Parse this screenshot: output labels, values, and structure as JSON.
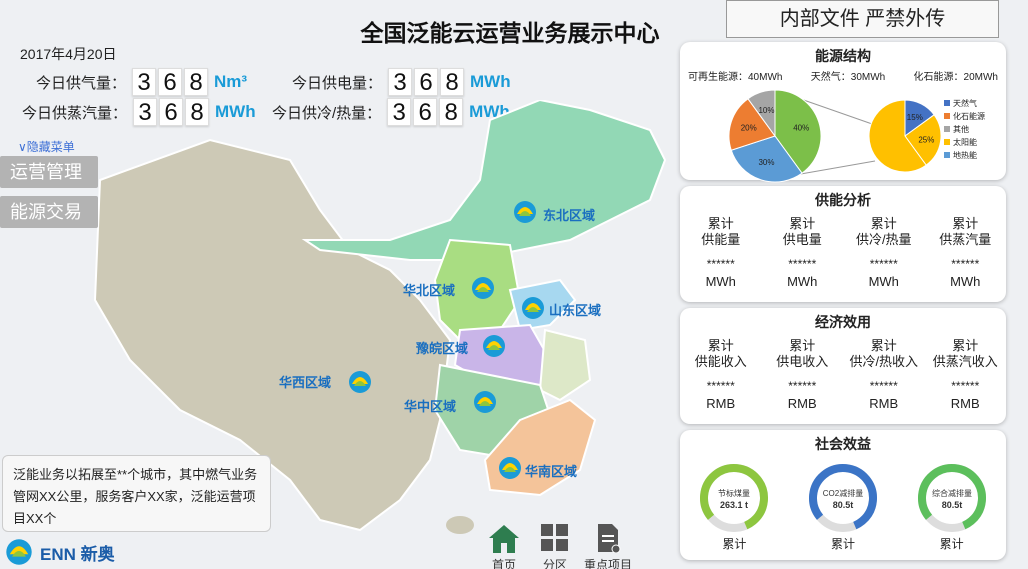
{
  "header": {
    "title": "全国泛能云运营业务展示中心",
    "notice": "内部文件  严禁外传",
    "date": "2017年4月20日"
  },
  "stats": {
    "gas": {
      "label": "今日供气量：",
      "digits": [
        "3",
        "6",
        "8"
      ],
      "unit": "Nm³"
    },
    "steam": {
      "label": "今日供蒸汽量：",
      "digits": [
        "3",
        "6",
        "8"
      ],
      "unit": "MWh"
    },
    "electricity": {
      "label": "今日供电量：",
      "digits": [
        "3",
        "6",
        "8"
      ],
      "unit": "MWh"
    },
    "heat": {
      "label": "今日供冷/热量：",
      "digits": [
        "3",
        "6",
        "8"
      ],
      "unit": "MWh"
    }
  },
  "sidebar": {
    "hide_menu": "∨隐藏菜单",
    "items": [
      {
        "label": "运营管理"
      },
      {
        "label": "能源交易"
      }
    ]
  },
  "map": {
    "regions": [
      {
        "label": "东北区域"
      },
      {
        "label": "华北区域"
      },
      {
        "label": "山东区域"
      },
      {
        "label": "豫皖区域"
      },
      {
        "label": "华西区域"
      },
      {
        "label": "华中区域"
      },
      {
        "label": "华南区域"
      }
    ]
  },
  "info": {
    "text": "泛能业务以拓展至**个城市，其中燃气业务管网XX公里，服务客户XX家，泛能运营项目XX个"
  },
  "logo": {
    "text": "ENN 新奥"
  },
  "nav": {
    "home": "首页",
    "region": "分区",
    "projects": "重点项目"
  },
  "energy_structure": {
    "title": "能源结构",
    "legend_top": [
      "可再生能源：40MWh",
      "天然气：30MWh",
      "化石能源：20MWh"
    ],
    "chart_data": {
      "type": "pie",
      "pie1": {
        "slices": [
          {
            "label": "40%",
            "value": 40,
            "color": "#7cbf49"
          },
          {
            "label": "30%",
            "value": 30,
            "color": "#5b9bd5"
          },
          {
            "label": "20%",
            "value": 20,
            "color": "#ed7d31"
          },
          {
            "label": "10%",
            "value": 10,
            "color": "#a5a5a5"
          }
        ]
      },
      "pie2": {
        "slices": [
          {
            "label": "15%",
            "value": 15,
            "color": "#4472c4"
          },
          {
            "label": "25%",
            "value": 25,
            "color": "#ffc000"
          },
          {
            "label": "",
            "value": 60,
            "color": "#ffc000"
          }
        ],
        "legend": [
          {
            "name": "天然气",
            "color": "#4472c4"
          },
          {
            "name": "化石能源",
            "color": "#ed7d31"
          },
          {
            "name": "其他",
            "color": "#a5a5a5"
          },
          {
            "name": "太阳能",
            "color": "#ffc000"
          },
          {
            "name": "地热能",
            "color": "#5b9bd5"
          }
        ]
      }
    }
  },
  "supply": {
    "title": "供能分析",
    "items": [
      {
        "l1": "累计",
        "l2": "供能量",
        "val": "******",
        "unit": "MWh"
      },
      {
        "l1": "累计",
        "l2": "供电量",
        "val": "******",
        "unit": "MWh"
      },
      {
        "l1": "累计",
        "l2": "供冷/热量",
        "val": "******",
        "unit": "MWh"
      },
      {
        "l1": "累计",
        "l2": "供蒸汽量",
        "val": "******",
        "unit": "MWh"
      }
    ]
  },
  "economic": {
    "title": "经济效用",
    "items": [
      {
        "l1": "累计",
        "l2": "供能收入",
        "val": "******",
        "unit": "RMB"
      },
      {
        "l1": "累计",
        "l2": "供电收入",
        "val": "******",
        "unit": "RMB"
      },
      {
        "l1": "累计",
        "l2": "供冷/热收入",
        "val": "******",
        "unit": "RMB"
      },
      {
        "l1": "累计",
        "l2": "供蒸汽收入",
        "val": "******",
        "unit": "RMB"
      }
    ]
  },
  "social": {
    "title": "社会效益",
    "gauges": [
      {
        "name": "节标煤量",
        "value": "263.1 t",
        "caption": "累计",
        "color": "#8dc63f"
      },
      {
        "name": "CO2减排量",
        "value": "80.5t",
        "caption": "累计",
        "color": "#3b74c6"
      },
      {
        "name": "综合减排量",
        "value": "80.5t",
        "caption": "累计",
        "color": "#5cbf5c"
      }
    ]
  }
}
